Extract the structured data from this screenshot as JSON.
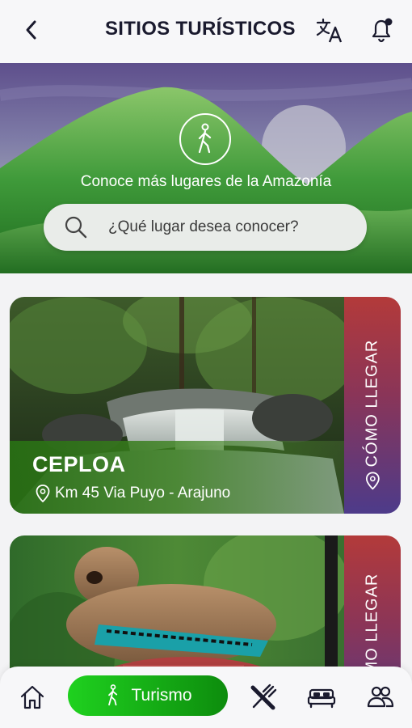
{
  "header": {
    "title": "SITIOS TURÍSTICOS",
    "back_icon": "chevron-left-icon",
    "translate_icon": "translate-icon",
    "notification_icon": "bell-icon"
  },
  "hero": {
    "icon": "walking-person-icon",
    "subtitle": "Conoce más lugares de la Amazonía",
    "search": {
      "placeholder": "¿Qué lugar desea conocer?",
      "value": ""
    }
  },
  "places": [
    {
      "name": "CEPLOA",
      "location": "Km 45 Via Puyo - Arajuno",
      "action_label": "CÓMO LLEGAR"
    },
    {
      "name": "",
      "location": "",
      "action_label": "CÓMO LLEGAR"
    }
  ],
  "bottom_nav": {
    "items": [
      {
        "icon": "home-icon",
        "active": false
      },
      {
        "icon": "walking-person-icon",
        "label": "Turismo",
        "active": true
      },
      {
        "icon": "fork-knife-icon",
        "active": false
      },
      {
        "icon": "bed-icon",
        "active": false
      },
      {
        "icon": "users-icon",
        "active": false
      }
    ]
  },
  "colors": {
    "active_green": "#14a814",
    "ribbon_top": "#b33a3a",
    "ribbon_bottom": "#4d3b8a",
    "title_text": "#1a1a2e"
  }
}
